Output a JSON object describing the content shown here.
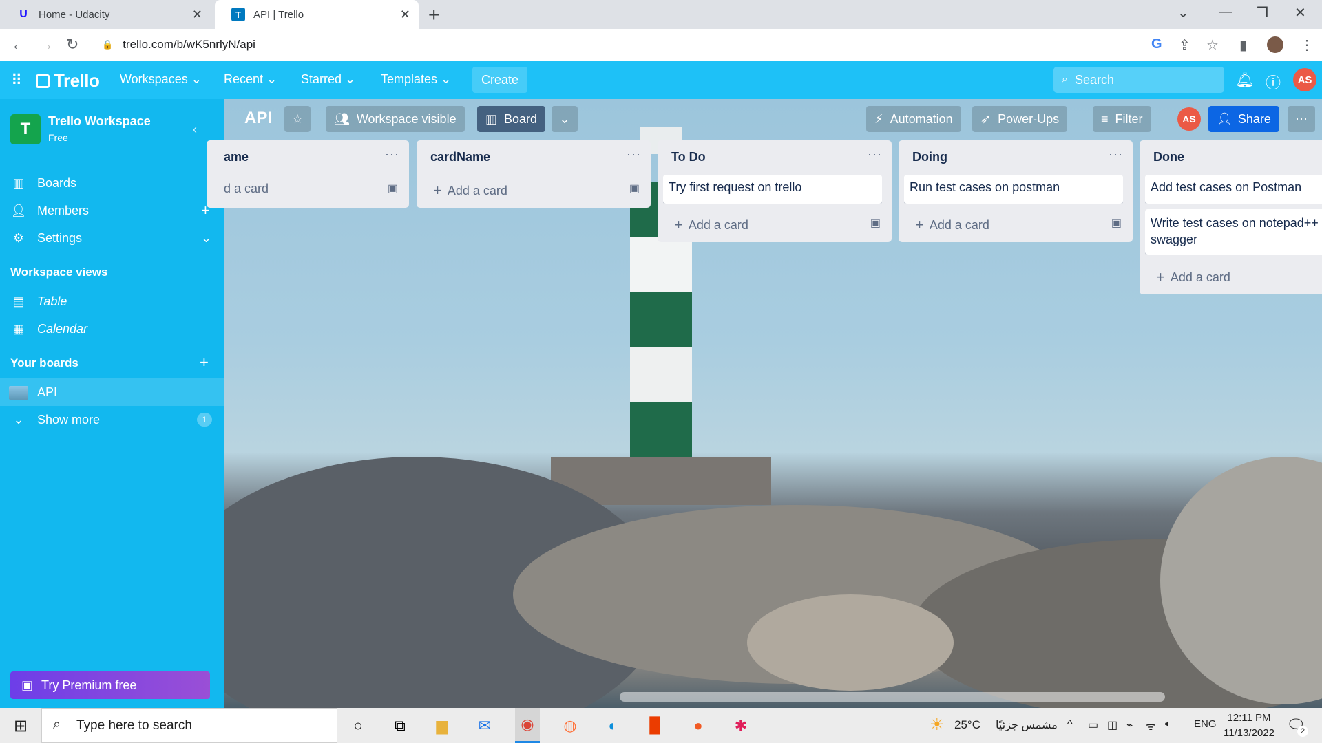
{
  "browser": {
    "tabs": [
      {
        "title": "Home - Udacity",
        "favicon": "U"
      },
      {
        "title": "API | Trello",
        "favicon": "T"
      }
    ],
    "url": "trello.com/b/wK5nrlyN/api"
  },
  "header": {
    "logo": "Trello",
    "nav": [
      "Workspaces",
      "Recent",
      "Starred",
      "Templates"
    ],
    "create_label": "Create",
    "search_placeholder": "Search",
    "avatar_initials": "AS"
  },
  "sidebar": {
    "workspace_initial": "T",
    "workspace_name": "Trello Workspace",
    "plan": "Free",
    "items": [
      {
        "label": "Boards",
        "icon": "trello-board-icon"
      },
      {
        "label": "Members",
        "icon": "person-icon"
      },
      {
        "label": "Settings",
        "icon": "gear-icon"
      }
    ],
    "views_heading": "Workspace views",
    "views": [
      {
        "label": "Table",
        "icon": "table-icon"
      },
      {
        "label": "Calendar",
        "icon": "calendar-icon"
      }
    ],
    "boards_heading": "Your boards",
    "boards": [
      {
        "label": "API"
      }
    ],
    "show_more": "Show more",
    "show_more_count": "1",
    "premium_label": "Try Premium free"
  },
  "board": {
    "title": "API",
    "visibility": "Workspace visible",
    "view": "Board",
    "automation": "Automation",
    "powerups": "Power-Ups",
    "filter": "Filter",
    "share": "Share",
    "avatar_initials": "AS"
  },
  "lists": [
    {
      "title": "ame",
      "cards": [],
      "add": "d a card"
    },
    {
      "title": "cardName",
      "cards": [],
      "add": "Add a card"
    },
    {
      "title": "To Do",
      "cards": [
        "Try first request on trello"
      ],
      "add": "Add a card"
    },
    {
      "title": "Doing",
      "cards": [
        "Run test cases on postman"
      ],
      "add": "Add a card"
    },
    {
      "title": "Done",
      "cards": [
        "Add test cases on Postman",
        "Write test cases on notepad++ swagger"
      ],
      "add": "Add a card"
    }
  ],
  "taskbar": {
    "search_placeholder": "Type here to search",
    "weather": "25°C",
    "weather_text": "مشمس جزئيًا",
    "lang": "ENG",
    "time": "12:11 PM",
    "date": "11/13/2022",
    "notification_count": "2"
  }
}
